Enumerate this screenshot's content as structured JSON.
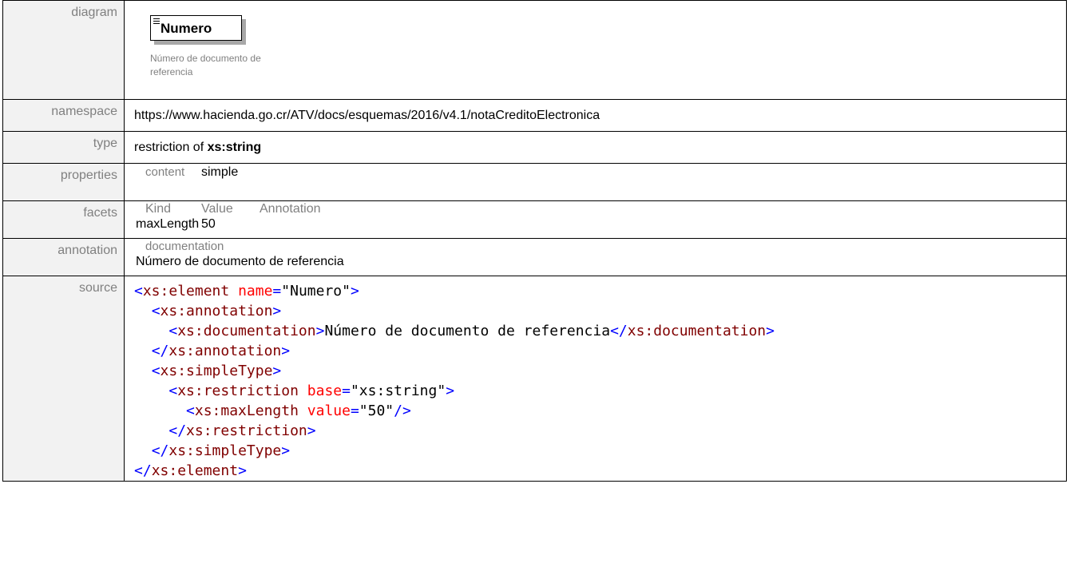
{
  "rows": {
    "diagram": {
      "label": "diagram",
      "element_name": "Numero",
      "note": "Número de documento de referencia"
    },
    "namespace": {
      "label": "namespace",
      "value": "https://www.hacienda.go.cr/ATV/docs/esquemas/2016/v4.1/notaCreditoElectronica"
    },
    "type": {
      "label": "type",
      "prefix": "restriction of ",
      "base": "xs:string"
    },
    "properties": {
      "label": "properties",
      "key": "content",
      "value": "simple"
    },
    "facets": {
      "label": "facets",
      "headers": [
        "Kind",
        "Value",
        "Annotation"
      ],
      "kind": "maxLength",
      "value": "50"
    },
    "annotation": {
      "label": "annotation",
      "head": "documentation",
      "text": "Número de documento de referencia"
    },
    "source": {
      "label": "source",
      "l1_open": "<",
      "l1_tag": "xs:element",
      "l1_attr": "name",
      "l1_eq": "=",
      "l1_val": "\"Numero\"",
      "l1_close": ">",
      "l2": "xs:annotation",
      "l3_tag": "xs:documentation",
      "l3_text": "Número de documento de referencia",
      "l3_end": "xs:documentation",
      "l4": "xs:annotation",
      "l5": "xs:simpleType",
      "l6_tag": "xs:restriction",
      "l6_attr": "base",
      "l6_val": "\"xs:string\"",
      "l7_tag": "xs:maxLength",
      "l7_attr": "value",
      "l7_val": "\"50\"",
      "l8": "xs:restriction",
      "l9": "xs:simpleType",
      "l10": "xs:element"
    }
  },
  "colors": {
    "tag": "#0000ff",
    "tag_name": "#800000",
    "attr_name": "#ff0000",
    "label_bg": "#f2f2f2",
    "label_text": "#808080"
  }
}
